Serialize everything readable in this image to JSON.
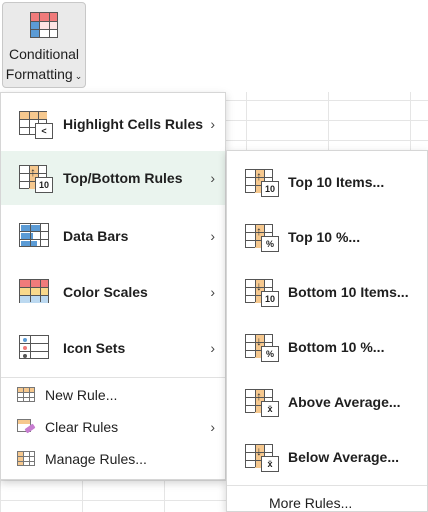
{
  "ribbon": {
    "button_line1": "Conditional",
    "button_line2": "Formatting",
    "chevron": "⌄",
    "icon": "conditional-formatting-icon"
  },
  "menu": {
    "items": [
      {
        "label": "Highlight Cells Rules",
        "icon": "highlight-cells-icon",
        "badge": "<"
      },
      {
        "label": "Top/Bottom Rules",
        "icon": "top-bottom-icon",
        "badge": "10"
      },
      {
        "label": "Data Bars",
        "icon": "data-bars-icon"
      },
      {
        "label": "Color Scales",
        "icon": "color-scales-icon"
      },
      {
        "label": "Icon Sets",
        "icon": "icon-sets-icon"
      }
    ],
    "small_items": [
      {
        "label": "New Rule...",
        "icon": "new-rule-icon"
      },
      {
        "label": "Clear Rules",
        "icon": "clear-rules-icon"
      },
      {
        "label": "Manage Rules...",
        "icon": "manage-rules-icon"
      }
    ],
    "arrow": "›"
  },
  "submenu": {
    "items": [
      {
        "label": "Top 10 Items...",
        "badge": "10",
        "icon": "top-10-items-icon"
      },
      {
        "label": "Top 10 %...",
        "badge": "%",
        "icon": "top-10-percent-icon"
      },
      {
        "label": "Bottom 10 Items...",
        "badge": "10",
        "icon": "bottom-10-items-icon"
      },
      {
        "label": "Bottom 10 %...",
        "badge": "%",
        "icon": "bottom-10-percent-icon"
      },
      {
        "label": "Above Average...",
        "badge": "x̄",
        "icon": "above-average-icon"
      },
      {
        "label": "Below Average...",
        "badge": "x̄",
        "icon": "below-average-icon"
      }
    ],
    "more": "More Rules..."
  },
  "colors": {
    "active_bg": "#eaf4ee",
    "highlight": "#f6c88e",
    "red": "#f07b7b",
    "blue": "#5b9bd5"
  }
}
